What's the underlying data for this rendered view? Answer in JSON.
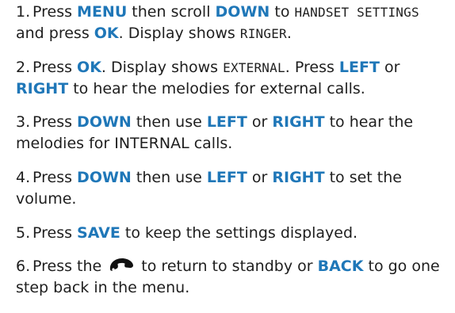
{
  "steps": [
    {
      "number": "1.",
      "t1": "Press ",
      "k1": "MENU",
      "t2": " then scroll ",
      "k2": "DOWN",
      "t3": " to ",
      "lcd1": "HANDSET SETTINGS",
      "t4": " and press ",
      "k3": "OK",
      "t5": ". Display shows ",
      "lcd2": "RINGER",
      "t6": "."
    },
    {
      "number": "2.",
      "t1": "Press ",
      "k1": "OK",
      "t2": ". Display shows ",
      "lcd1": "EXTERNAL",
      "t3": ". Press ",
      "k2": "LEFT",
      "t4": " or ",
      "k3": "RIGHT",
      "t5": " to hear the melodies for external calls."
    },
    {
      "number": "3.",
      "t1": "Press ",
      "k1": "DOWN",
      "t2": " then use ",
      "k2": "LEFT",
      "t3": " or ",
      "k3": "RIGHT",
      "t4": " to hear the melodies for INTERNAL calls."
    },
    {
      "number": "4.",
      "t1": "Press ",
      "k1": "DOWN",
      "t2": " then use ",
      "k2": "LEFT",
      "t3": " or ",
      "k3": "RIGHT",
      "t4": " to set the volume."
    },
    {
      "number": "5.",
      "t1": "Press ",
      "k1": "SAVE",
      "t2": " to keep the settings displayed."
    },
    {
      "number": "6.",
      "t1": "Press the ",
      "icon": "hang-up-phone-icon",
      "t2": " to return to standby or ",
      "k1": "BACK",
      "t3": " to go one step back in the menu."
    }
  ],
  "colors": {
    "keyword": "#1f77b8",
    "text": "#1e1e1e",
    "icon": "#111111"
  }
}
